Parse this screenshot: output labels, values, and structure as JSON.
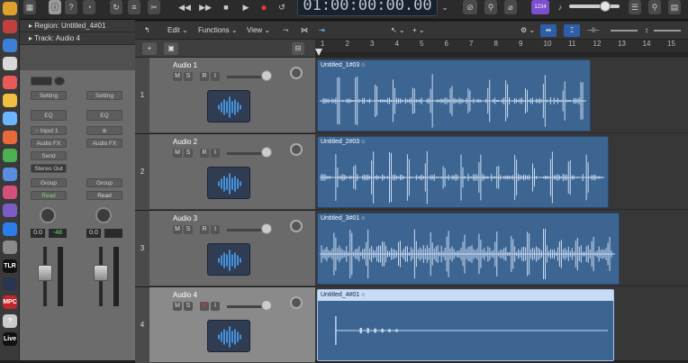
{
  "dock": {
    "icons": [
      {
        "name": "app-icon",
        "bg": "#e0a02c",
        "label": ""
      },
      {
        "name": "app-icon",
        "bg": "#c04040",
        "label": ""
      },
      {
        "name": "app-icon",
        "bg": "#3d7fd6",
        "label": ""
      },
      {
        "name": "app-icon",
        "bg": "#d8d8d8",
        "label": ""
      },
      {
        "name": "app-icon",
        "bg": "#e85a5a",
        "label": ""
      },
      {
        "name": "app-icon",
        "bg": "#f0c040",
        "label": ""
      },
      {
        "name": "app-icon",
        "bg": "#6bb6ff",
        "label": ""
      },
      {
        "name": "app-icon",
        "bg": "#e86a3a",
        "label": ""
      },
      {
        "name": "app-icon",
        "bg": "#4caf50",
        "label": ""
      },
      {
        "name": "app-icon",
        "bg": "#5a8de0",
        "label": ""
      },
      {
        "name": "app-icon",
        "bg": "#d54f7b",
        "label": ""
      },
      {
        "name": "app-icon",
        "bg": "#7d5cc4",
        "label": ""
      },
      {
        "name": "app-icon",
        "bg": "#2b7de9",
        "label": ""
      },
      {
        "name": "app-icon",
        "bg": "#8a8a8a",
        "label": ""
      },
      {
        "name": "app-icon",
        "bg": "#111111",
        "label": "TLR"
      },
      {
        "name": "app-icon",
        "bg": "#2a3550",
        "label": ""
      },
      {
        "name": "app-icon",
        "bg": "#c0272d",
        "label": "MPC"
      },
      {
        "name": "app-icon",
        "bg": "#cccccc",
        "label": "?"
      },
      {
        "name": "app-icon",
        "bg": "#111111",
        "label": "Live"
      }
    ]
  },
  "transport": {
    "lcd": "01:00:00:00.00",
    "count_in": "1234"
  },
  "inspector": {
    "region_label": "Region: Untitled_4#01",
    "track_label": "Track: Audio 4",
    "strip1": {
      "setting": "Setting",
      "eq": "EQ",
      "input": "Input 1",
      "audio_fx": "Audio FX",
      "send": "Send",
      "output": "Stereo Out",
      "group": "Group",
      "read": "Read",
      "pan_value": "0.0",
      "level_value": "-48"
    },
    "strip2": {
      "setting": "Setting",
      "eq": "EQ",
      "audio_fx": "Audio FX",
      "group": "Group",
      "read": "Read",
      "pan_value": "0.0"
    }
  },
  "toolbar": {
    "edit": "Edit",
    "functions": "Functions",
    "view": "View"
  },
  "ruler": {
    "marks": [
      "1",
      "2",
      "3",
      "4",
      "5",
      "6",
      "7",
      "8",
      "9",
      "10",
      "11",
      "12",
      "13",
      "14",
      "15"
    ]
  },
  "tracks": [
    {
      "number": "1",
      "name": "Audio 1",
      "m": "M",
      "s": "S",
      "r": "R",
      "i": "I",
      "region": "Untitled_1#03"
    },
    {
      "number": "2",
      "name": "Audio 2",
      "m": "M",
      "s": "S",
      "r": "R",
      "i": "I",
      "region": "Untitled_2#03"
    },
    {
      "number": "3",
      "name": "Audio 3",
      "m": "M",
      "s": "S",
      "r": "R",
      "i": "I",
      "region": "Untitled_3#01"
    },
    {
      "number": "4",
      "name": "Audio 4",
      "m": "M",
      "s": "S",
      "r": "R",
      "i": "I",
      "region": "Untitled_4#01"
    }
  ],
  "colors": {
    "region_blue": "#3d6592",
    "waveform": "#c9dcf2",
    "read_green": "#7ddc6a",
    "level_green": "#5fdc5f",
    "record_red": "#e03a3a"
  }
}
